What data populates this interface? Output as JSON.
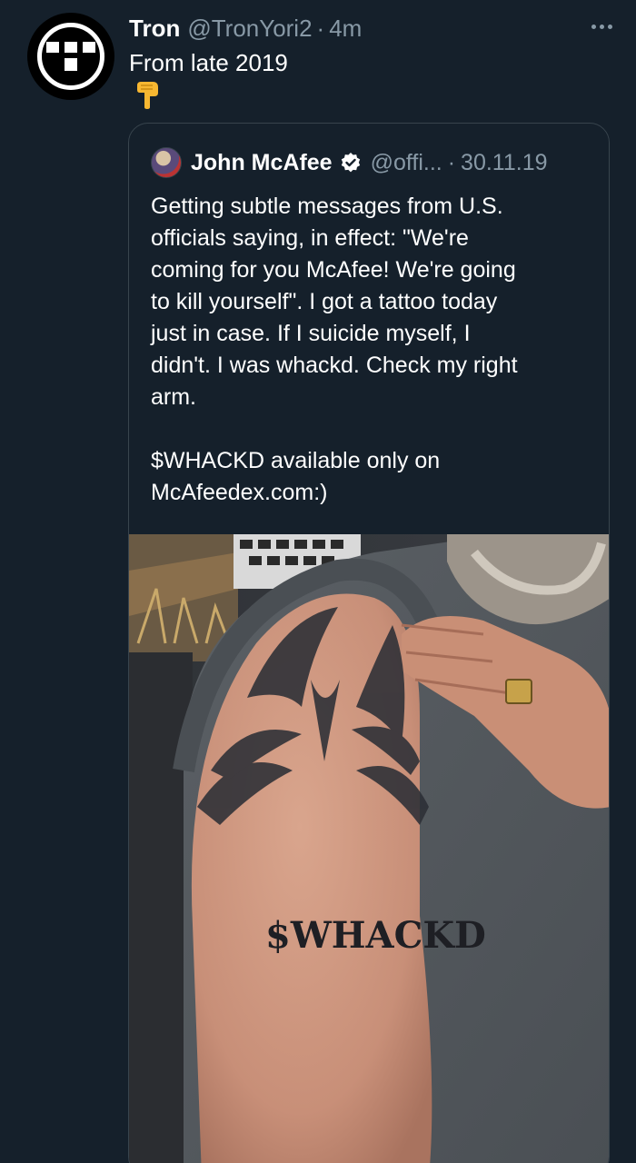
{
  "tweet": {
    "author_name": "Tron",
    "handle": "@TronYori2",
    "separator": "·",
    "time": "4m",
    "text": "From late 2019",
    "emoji_icon": "pointing-down-hand-icon",
    "more_icon": "more-options-icon"
  },
  "quoted": {
    "author_name": "John McAfee",
    "handle": "@offi...",
    "separator": "·",
    "date": "30.11.19",
    "verified_icon": "verified-badge-icon",
    "body": "Getting subtle messages from U.S.\nofficials saying, in effect: \"We're\ncoming for you McAfee! We're going\nto kill yourself\". I got a tattoo today\njust in case. If I suicide myself, I\ndidn't. I was whackd. Check my right\narm.\n\n$WHACKD available only on\nMcAfeedex.com:)",
    "image": {
      "tattoo_text": "$WHACKD"
    }
  },
  "colors": {
    "background": "#15202b",
    "secondary_text": "#8899a6",
    "border": "#38444d",
    "verified": "#1da1f2"
  }
}
